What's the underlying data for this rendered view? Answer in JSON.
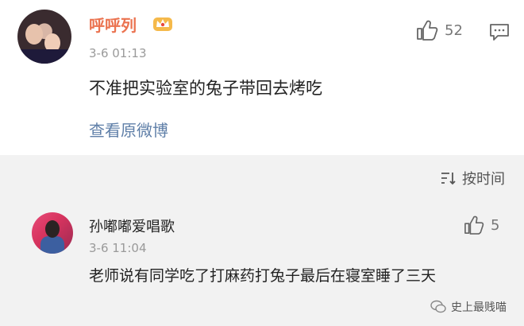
{
  "comment1": {
    "author": "呼呼列",
    "time": "3-6 01:13",
    "text": "不准把实验室的兔子带回去烤吃",
    "likes": "52",
    "view_original": "查看原微博"
  },
  "sort": {
    "label": "按时间"
  },
  "comment2": {
    "author": "孙嘟嘟爱唱歌",
    "time": "3-6 11:04",
    "text": "老师说有同学吃了打麻药打兔子最后在寝室睡了三天",
    "likes": "5"
  },
  "watermark": {
    "text": "史上最贱喵"
  },
  "colors": {
    "author_accent": "#eb7350",
    "link": "#5f7fa8",
    "bar_bg": "#f2f2f2"
  },
  "icons": [
    "crown-badge-icon",
    "thumbs-up-icon",
    "comment-icon",
    "sort-icon",
    "wechat-icon"
  ]
}
